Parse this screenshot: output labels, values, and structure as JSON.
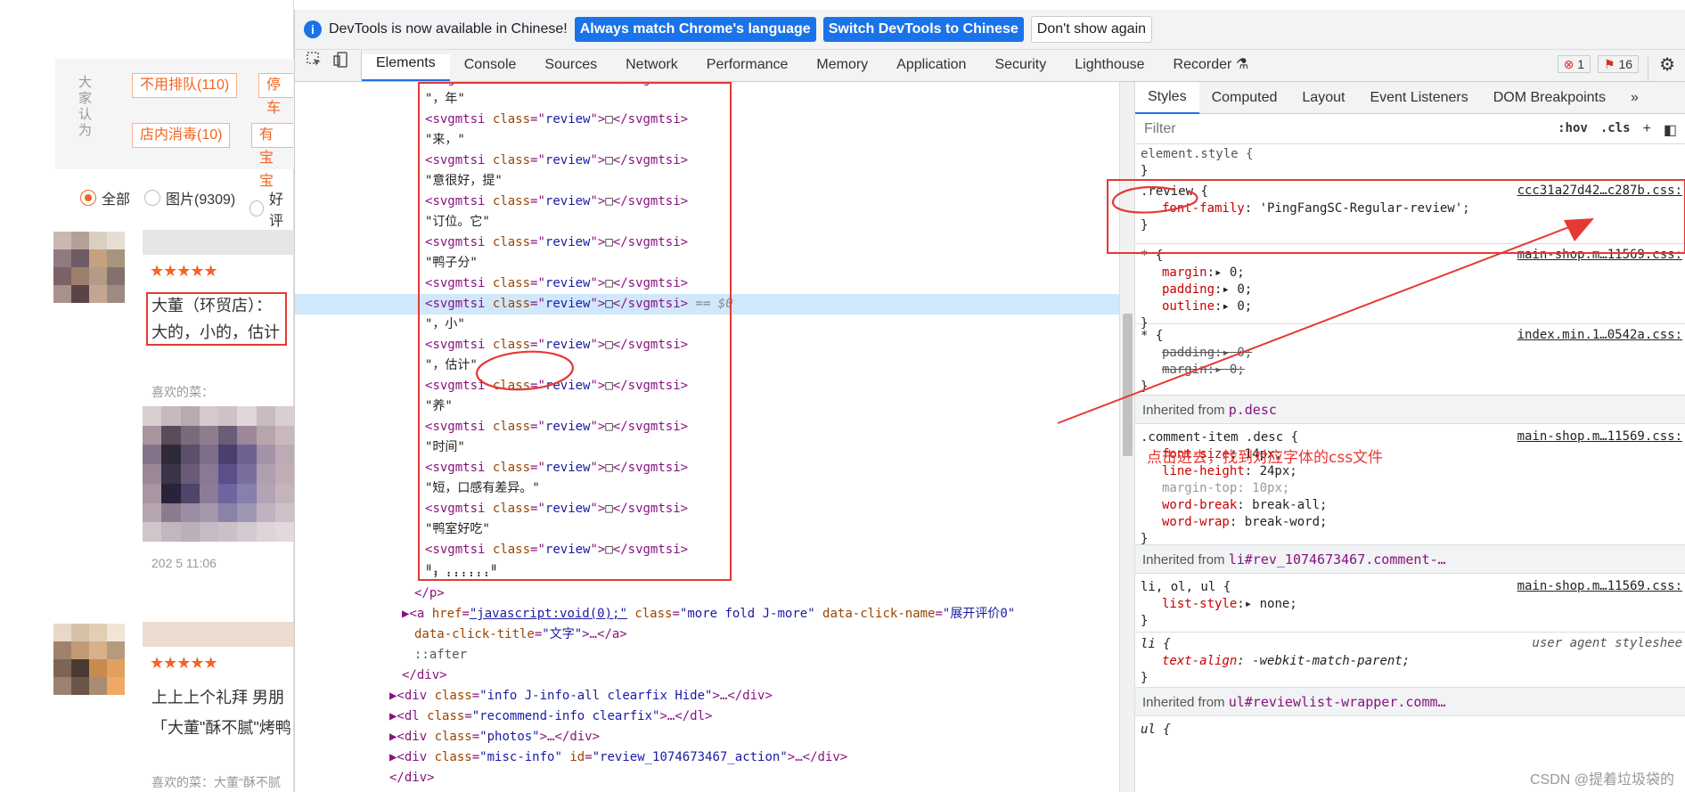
{
  "left_page": {
    "vertical_label": "大家认为",
    "tags": [
      "不用排队(110)",
      "停车",
      "店内消毒(10)",
      "有宝宝"
    ],
    "filters": [
      "全部",
      "图片(9309)",
      "好评"
    ],
    "reviews": [
      {
        "stars": "★★★★★",
        "text_line1": "大董（环贸店）：",
        "text_line2": "大的，小的，估计",
        "recommend_label": "喜欢的菜：",
        "date": "202 5 11:06"
      },
      {
        "stars": "★★★★★",
        "text_line1": "上上上个礼拜 男朋",
        "text_line2": "「大董\"酥不腻\"烤鸭",
        "recommend_label": "喜欢的菜：大董\"酥不腻",
        "date": ""
      }
    ],
    "ellipsis": "…"
  },
  "devtools": {
    "infobar": {
      "message": "DevTools is now available in Chinese!",
      "btn_match": "Always match Chrome's language",
      "btn_switch": "Switch DevTools to Chinese",
      "btn_dismiss": "Don't show again"
    },
    "tabs": [
      "Elements",
      "Console",
      "Sources",
      "Network",
      "Performance",
      "Memory",
      "Application",
      "Security",
      "Lighthouse",
      "Recorder"
    ],
    "errors": "1",
    "warnings": "16",
    "styles_tabs": [
      "Styles",
      "Computed",
      "Layout",
      "Event Listeners",
      "DOM Breakpoints"
    ],
    "filter_placeholder": "Filter",
    "hov": ":hov",
    "cls": ".cls",
    "dom_lines": [
      {
        "kind": "text",
        "text": "\"，年\""
      },
      {
        "kind": "svg",
        "tag": "svgmtsi",
        "attr": "class",
        "val": "review",
        "glyph": "□"
      },
      {
        "kind": "text",
        "text": "\"来，\""
      },
      {
        "kind": "svg",
        "tag": "svgmtsi",
        "attr": "class",
        "val": "review",
        "glyph": "□"
      },
      {
        "kind": "text",
        "text": "\"意很好，提\""
      },
      {
        "kind": "svg",
        "tag": "svgmtsi",
        "attr": "class",
        "val": "review",
        "glyph": "□"
      },
      {
        "kind": "text",
        "text": "\"订位。它\""
      },
      {
        "kind": "svg",
        "tag": "svgmtsi",
        "attr": "class",
        "val": "review",
        "glyph": "□"
      },
      {
        "kind": "text",
        "text": "\"鸭子分\""
      },
      {
        "kind": "svg",
        "tag": "svgmtsi",
        "attr": "class",
        "val": "review",
        "glyph": "□"
      },
      {
        "kind": "svg",
        "tag": "svgmtsi",
        "attr": "class",
        "val": "review",
        "glyph": "□",
        "selected": true,
        "suffix": " == $0"
      },
      {
        "kind": "text",
        "text": "\"，小\""
      },
      {
        "kind": "svg",
        "tag": "svgmtsi",
        "attr": "class",
        "val": "review",
        "glyph": "□"
      },
      {
        "kind": "text",
        "text": "\"，估计\""
      },
      {
        "kind": "svg",
        "tag": "svgmtsi",
        "attr": "class",
        "val": "review",
        "glyph": "□"
      },
      {
        "kind": "text",
        "text": "\"养\""
      },
      {
        "kind": "svg",
        "tag": "svgmtsi",
        "attr": "class",
        "val": "review",
        "glyph": "□"
      },
      {
        "kind": "text",
        "text": "\"时间\""
      },
      {
        "kind": "svg",
        "tag": "svgmtsi",
        "attr": "class",
        "val": "review",
        "glyph": "□"
      },
      {
        "kind": "text",
        "text": "\"短，口感有差异。\""
      },
      {
        "kind": "svg",
        "tag": "svgmtsi",
        "attr": "class",
        "val": "review",
        "glyph": "□"
      },
      {
        "kind": "text",
        "text": "\"鸭室好吃\""
      },
      {
        "kind": "svg",
        "tag": "svgmtsi",
        "attr": "class",
        "val": "review",
        "glyph": "□"
      },
      {
        "kind": "text",
        "text": "\"，......\""
      }
    ],
    "tail_lines": [
      "</p>",
      "▶<a href=\"javascript:void(0);\" class=\"more fold J-more\" data-click-name=\"展开评价0\"",
      "data-click-title=\"文字\">…</a>",
      "::after",
      "</div>",
      "▶<div class=\"info J-info-all clearfix Hide\">…</div>",
      "▶<dl class=\"recommend-info clearfix\">…</dl>",
      "▶<div class=\"photos\">…</div>",
      "▶<div class=\"misc-info\" id=\"review_1074673467_action\">…</div>",
      "</div>"
    ],
    "rules": {
      "element_style": "element.style {",
      "review_selector": ".review",
      "review_src": "ccc31a27d42…c287b.css:",
      "review_prop": "font-family",
      "review_val": "'PingFangSC-Regular-review';",
      "star1_src": "main-shop.m…11569.css:",
      "star1_props": [
        [
          "margin",
          "0;"
        ],
        [
          "padding",
          "0;"
        ],
        [
          "outline",
          "0;"
        ]
      ],
      "star2_src": "index.min.1…0542a.css:",
      "star2_props": [
        [
          "padding",
          "0;"
        ],
        [
          "margin",
          "0;"
        ]
      ],
      "inherited_desc": "p.desc",
      "desc_selector": ".comment-item .desc {",
      "desc_src": "main-shop.m…11569.css:",
      "desc_props": [
        [
          "font-size",
          "14px;"
        ],
        [
          "line-height",
          "24px;"
        ],
        [
          "margin-top",
          "10px;"
        ],
        [
          "word-break",
          "break-all;"
        ],
        [
          "word-wrap",
          "break-word;"
        ]
      ],
      "inherited_li": "li#rev_1074673467.comment-…",
      "li_selector": "li, ol, ul {",
      "li_src": "main-shop.m…11569.css:",
      "li_prop": "list-style",
      "li_val": "none;",
      "li2_selector": "li {",
      "li2_src": "user agent styleshee",
      "li2_prop": "text-align",
      "li2_val": "-webkit-match-parent;",
      "inherited_ul": "ul#reviewlist-wrapper.comm…",
      "ul_selector": "ul {"
    },
    "inherited_prefix": "Inherited from",
    "annotation": "点击进去，找到对应字体的css文件"
  },
  "watermark": "CSDN @提着垃圾袋的"
}
